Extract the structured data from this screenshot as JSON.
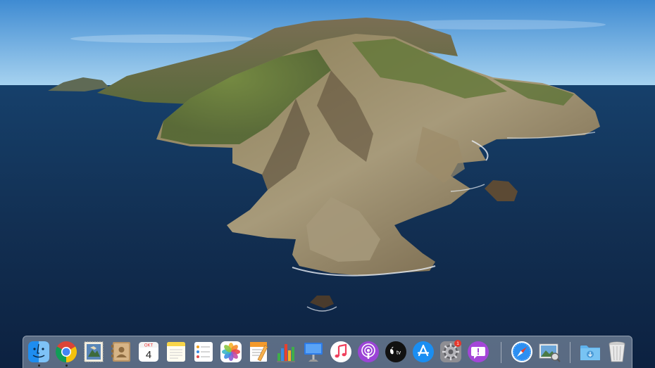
{
  "desktop": {
    "wallpaper": "catalina-island"
  },
  "dock": {
    "apps": [
      {
        "id": "finder",
        "icon": "finder-icon",
        "running": true
      },
      {
        "id": "chrome",
        "icon": "chrome-icon",
        "running": true
      },
      {
        "id": "mail-stamp",
        "icon": "stamp-icon"
      },
      {
        "id": "contacts",
        "icon": "contacts-icon"
      },
      {
        "id": "calendar",
        "icon": "calendar-icon",
        "month": "OKT",
        "day": "4"
      },
      {
        "id": "notes",
        "icon": "notes-icon"
      },
      {
        "id": "reminders",
        "icon": "reminders-icon"
      },
      {
        "id": "photos",
        "icon": "photos-icon"
      },
      {
        "id": "pages",
        "icon": "pages-icon"
      },
      {
        "id": "numbers",
        "icon": "numbers-icon"
      },
      {
        "id": "keynote",
        "icon": "keynote-icon"
      },
      {
        "id": "music",
        "icon": "music-icon"
      },
      {
        "id": "podcasts",
        "icon": "podcasts-icon"
      },
      {
        "id": "apple-tv",
        "icon": "apple-tv-icon",
        "label": "tv"
      },
      {
        "id": "app-store",
        "icon": "app-store-icon"
      },
      {
        "id": "system-preferences",
        "icon": "gear-icon",
        "badge": "1"
      },
      {
        "id": "feedback",
        "icon": "feedback-icon"
      },
      {
        "id": "safari",
        "icon": "safari-icon"
      },
      {
        "id": "preview",
        "icon": "preview-icon"
      },
      {
        "id": "downloads",
        "icon": "downloads-folder-icon"
      },
      {
        "id": "trash",
        "icon": "trash-icon"
      }
    ]
  },
  "colors": {
    "sky": "#4d96d6",
    "ocean": "#12335a",
    "dock_tint": "#d7e1f0",
    "badge": "#e5372c"
  }
}
